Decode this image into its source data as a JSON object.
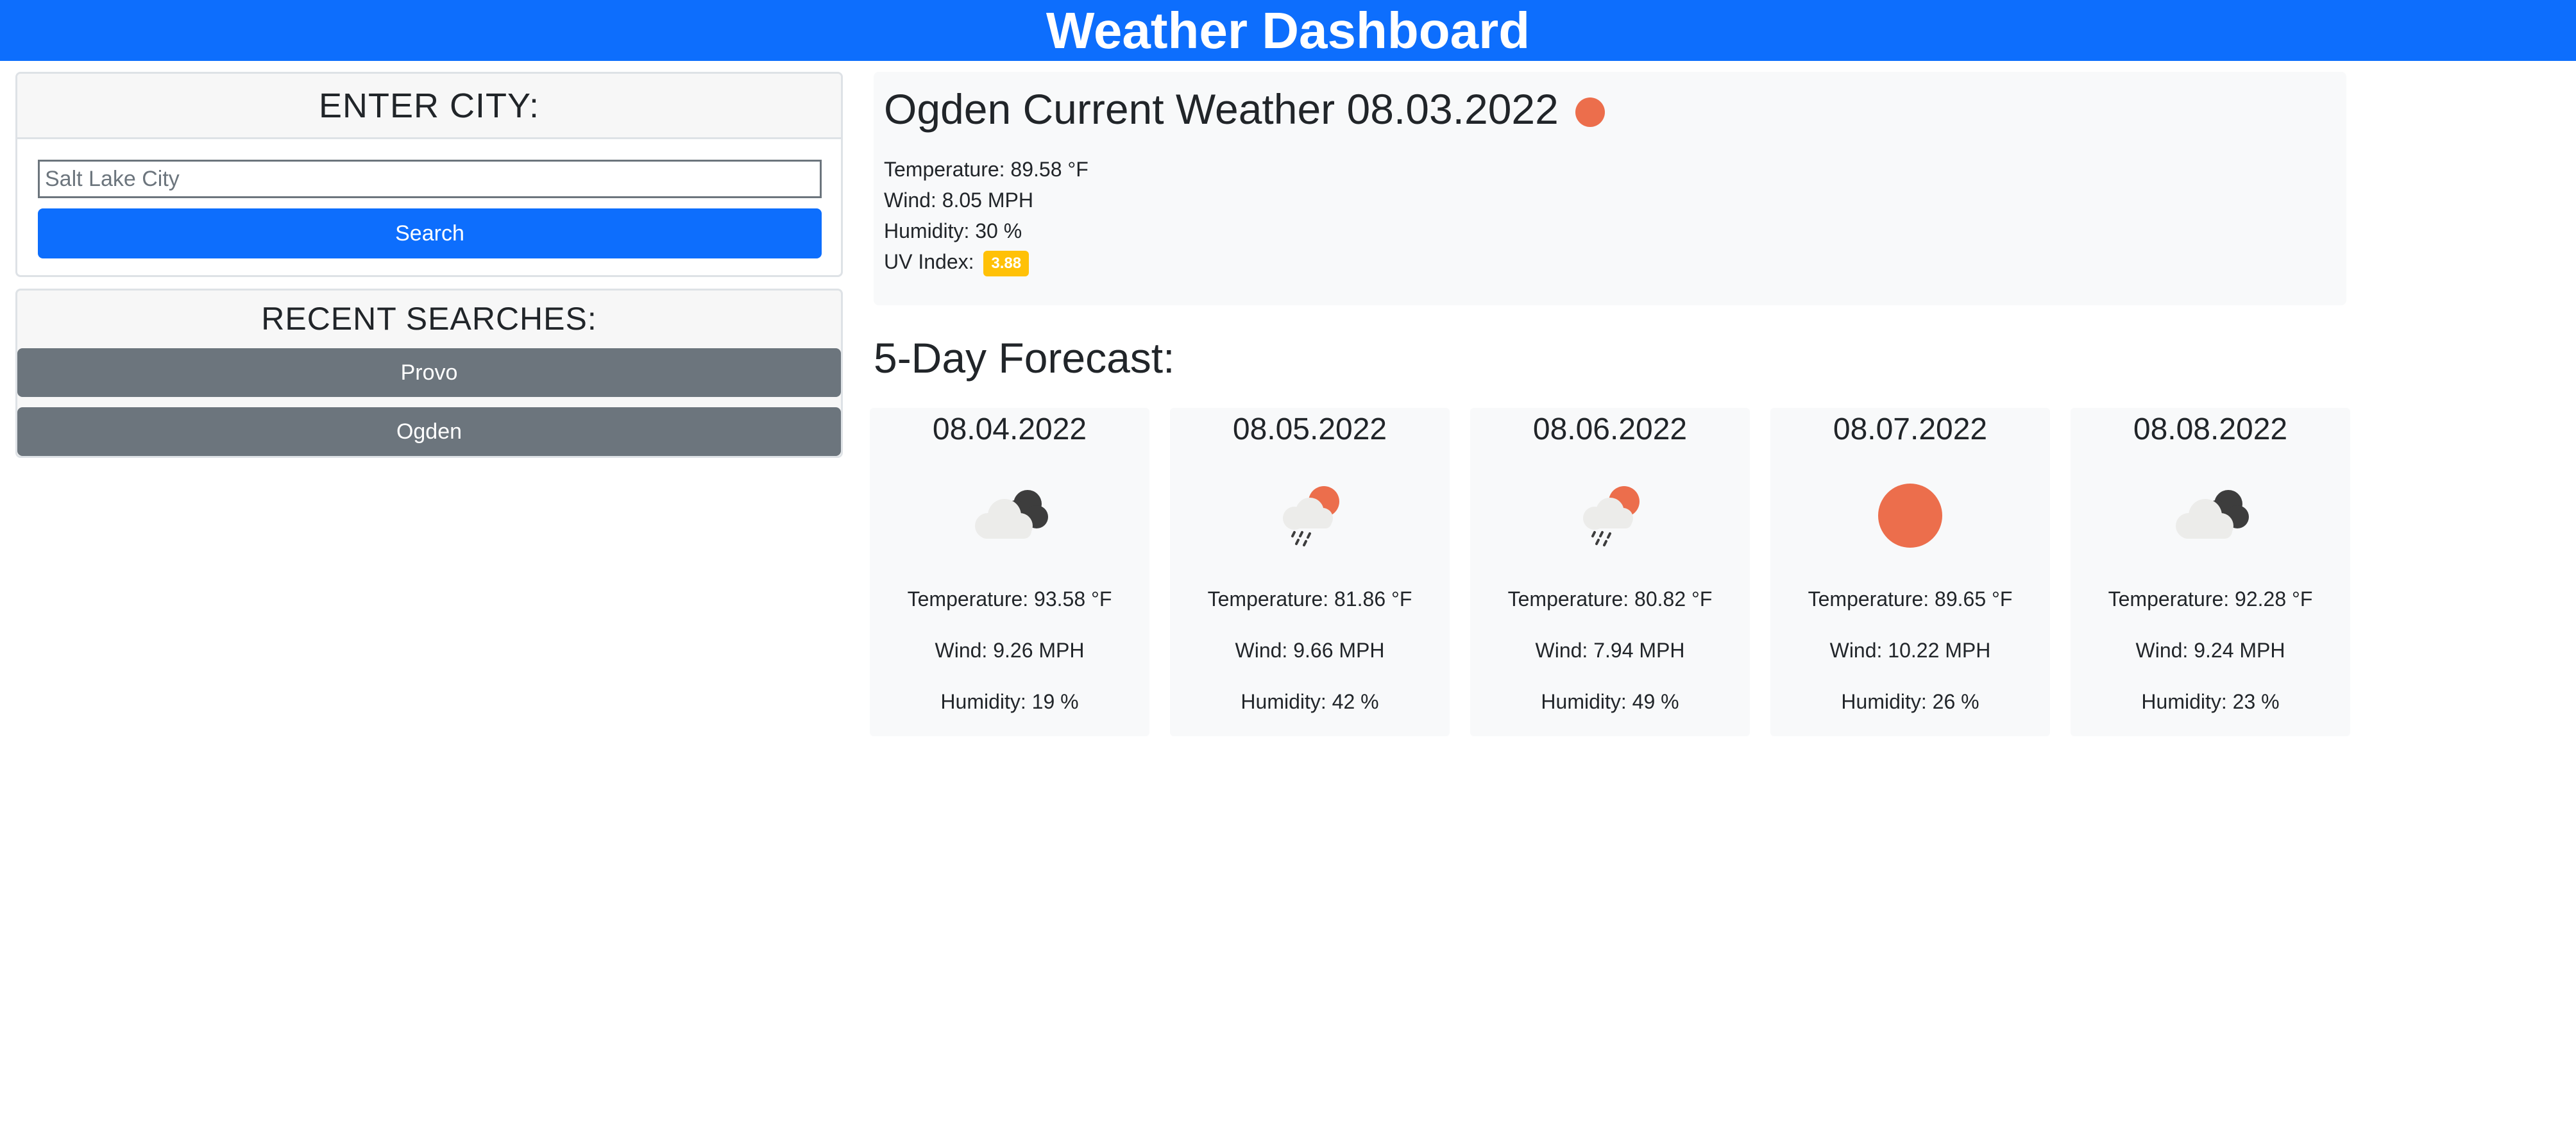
{
  "header": {
    "title": "Weather Dashboard"
  },
  "search": {
    "heading": "ENTER CITY:",
    "placeholder": "Salt Lake City",
    "button_label": "Search"
  },
  "recent": {
    "heading": "RECENT SEARCHES:",
    "items": [
      {
        "label": "Provo"
      },
      {
        "label": "Ogden"
      }
    ]
  },
  "current": {
    "title": "Ogden Current Weather 08.03.2022",
    "icon": "sun-icon",
    "temperature": "Temperature: 89.58 °F",
    "wind": "Wind: 8.05 MPH",
    "humidity": "Humidity: 30 %",
    "uv_label": "UV Index:",
    "uv_value": "3.88"
  },
  "forecast": {
    "heading": "5-Day Forecast:",
    "days": [
      {
        "date": "08.04.2022",
        "icon": "broken-clouds-icon",
        "temperature": "Temperature: 93.58 °F",
        "wind": "Wind: 9.26 MPH",
        "humidity": "Humidity: 19 %"
      },
      {
        "date": "08.05.2022",
        "icon": "rain-sun-icon",
        "temperature": "Temperature: 81.86 °F",
        "wind": "Wind: 9.66 MPH",
        "humidity": "Humidity: 42 %"
      },
      {
        "date": "08.06.2022",
        "icon": "rain-sun-icon",
        "temperature": "Temperature: 80.82 °F",
        "wind": "Wind: 7.94 MPH",
        "humidity": "Humidity: 49 %"
      },
      {
        "date": "08.07.2022",
        "icon": "sun-icon",
        "temperature": "Temperature: 89.65 °F",
        "wind": "Wind: 10.22 MPH",
        "humidity": "Humidity: 26 %"
      },
      {
        "date": "08.08.2022",
        "icon": "broken-clouds-icon",
        "temperature": "Temperature: 92.28 °F",
        "wind": "Wind: 9.24 MPH",
        "humidity": "Humidity: 23 %"
      }
    ]
  },
  "colors": {
    "primary": "#0d6efd",
    "secondary": "#6c757d",
    "uv_moderate": "#ffc107",
    "sun": "#ec6e4c",
    "panel": "#f8f9fa"
  }
}
